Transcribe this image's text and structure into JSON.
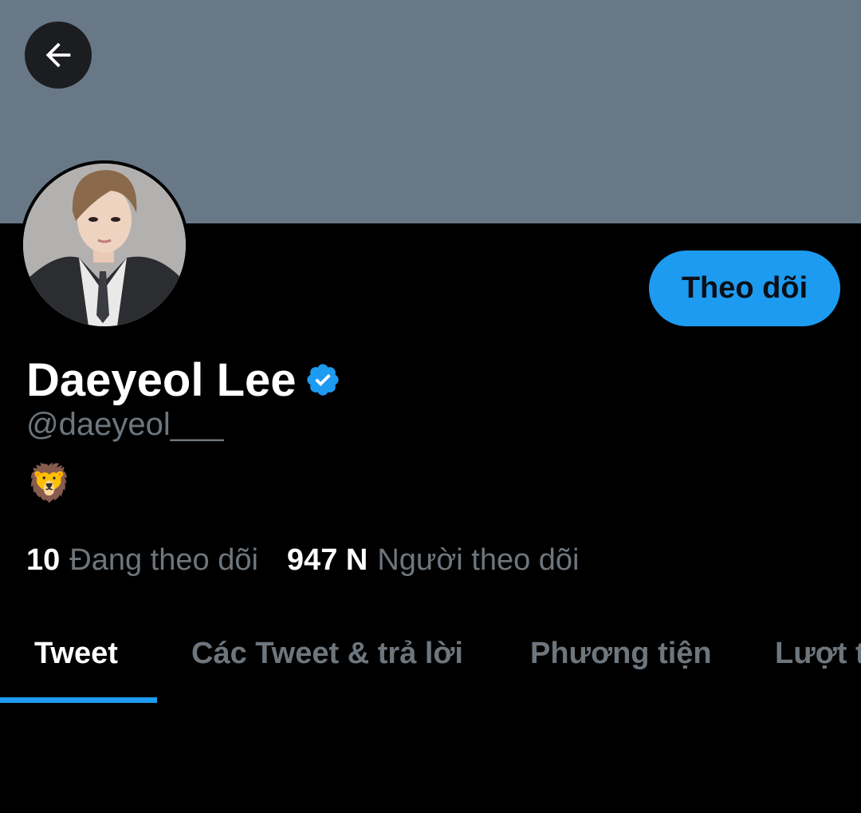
{
  "header": {
    "back_icon": "arrow-left-icon",
    "banner_color": "#687887"
  },
  "profile": {
    "display_name": "Daeyeol Lee",
    "verified_icon": "verified-badge-icon",
    "handle": "@daeyeol___",
    "bio": "🦁",
    "follow_label": "Theo dõi",
    "accent_color": "#1d9bf0"
  },
  "stats": {
    "following_count": "10",
    "following_label": "Đang theo dõi",
    "followers_count": "947 N",
    "followers_label": "Người theo dõi"
  },
  "tabs": [
    {
      "label": "Tweet",
      "active": true
    },
    {
      "label": "Các Tweet & trả lời",
      "active": false
    },
    {
      "label": "Phương tiện",
      "active": false
    },
    {
      "label": "Lượt t",
      "active": false
    }
  ]
}
